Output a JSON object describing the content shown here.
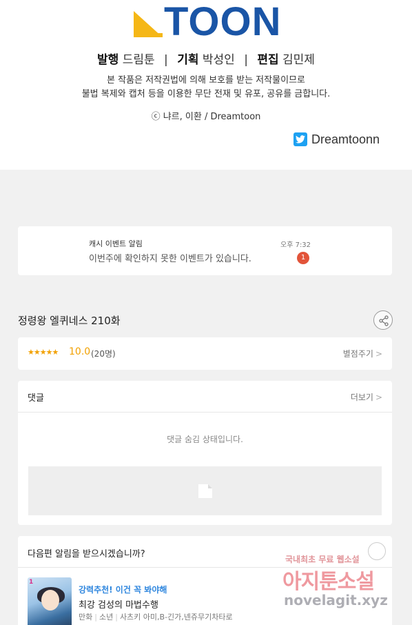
{
  "credits": {
    "logo_text": "TOON",
    "publisher_label": "발행",
    "publisher_value": "드림툰",
    "planning_label": "기획",
    "planning_value": "박성인",
    "editing_label": "편집",
    "editing_value": "김민제",
    "separator": "|",
    "notice_line1": "본 작품은 저작권법에 의해 보호를 받는 저작물이므로",
    "notice_line2": "불법 복제와 캡처 등을 이용한 무단 전재 및 유포, 공유를 금합니다.",
    "copyright": "ⓒ 냐르, 이환 / Dreamtoon",
    "twitter_handle": "Dreamtoonn"
  },
  "event": {
    "title": "캐시 이벤트 알림",
    "body": "이번주에 확인하지 못한 이벤트가 있습니다.",
    "time": "오후 7:32",
    "badge": "1"
  },
  "episode": {
    "title": "정령왕 엘퀴네스 210화"
  },
  "rating": {
    "stars": "★★★★★",
    "score": "10.0",
    "count": "(20명)",
    "rate_button": "별점주기",
    "chevron": ">"
  },
  "comments": {
    "header": "댓글",
    "more": "더보기",
    "chevron": ">",
    "hidden_message": "댓글 숨김 상태입니다."
  },
  "next": {
    "question": "다음편 알림을 받으시겠습니까?",
    "rec_tag": "강력추천! 이건 꼭 봐야해",
    "rec_title": "최강 검성의 마법수행",
    "rec_genre1": "만화",
    "rec_genre2": "소년",
    "rec_authors": "사츠키 아미,B-긴가,넨쥬무기차타로",
    "thumb_logo": "1"
  },
  "watermark": {
    "line1": "국내최초 무료 웹소설",
    "line2": "아지툰소설",
    "line3": "novelagit.xyz"
  },
  "colors": {
    "logo_blue": "#1a55a6",
    "logo_yellow": "#f5b716",
    "star": "#f2a100",
    "badge": "#e2543a",
    "rec_tag": "#2e86de",
    "twitter": "#1da1f2"
  },
  "icons": [
    "twitter-icon",
    "share-icon",
    "ad-placeholder-icon",
    "notification-icon"
  ]
}
